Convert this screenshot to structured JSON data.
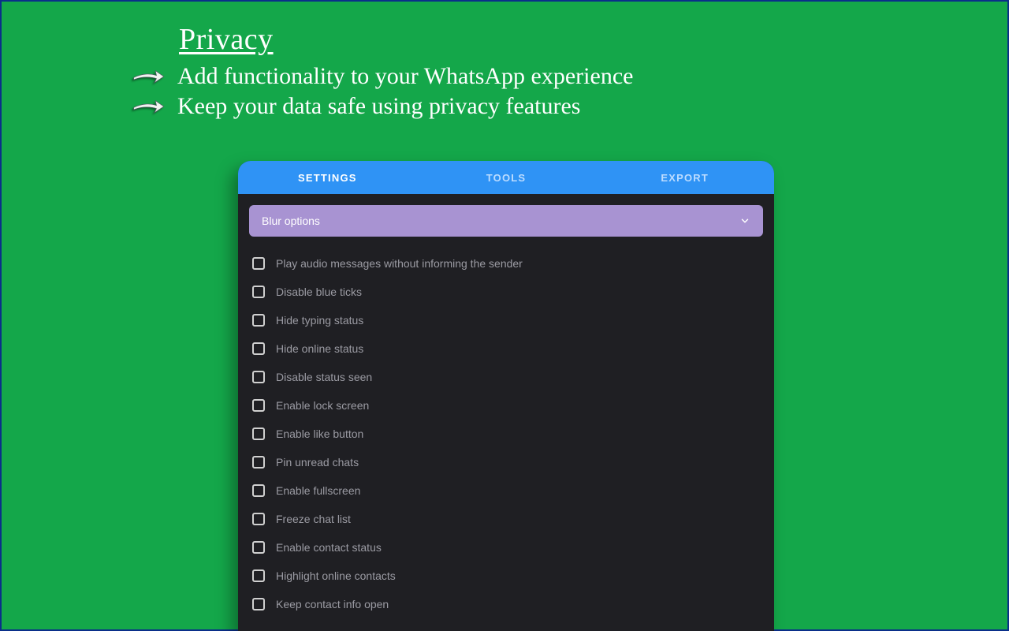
{
  "hero": {
    "title": "Privacy",
    "line1": "Add functionality to your WhatsApp experience",
    "line2": "Keep your data safe using privacy features"
  },
  "tabs": [
    {
      "label": "SETTINGS",
      "active": true
    },
    {
      "label": "TOOLS",
      "active": false
    },
    {
      "label": "EXPORT",
      "active": false
    }
  ],
  "dropdown": {
    "label": "Blur options"
  },
  "options": [
    {
      "label": "Play audio messages without informing the sender",
      "checked": false
    },
    {
      "label": "Disable blue ticks",
      "checked": false
    },
    {
      "label": "Hide typing status",
      "checked": false
    },
    {
      "label": "Hide online status",
      "checked": false
    },
    {
      "label": "Disable status seen",
      "checked": false
    },
    {
      "label": "Enable lock screen",
      "checked": false
    },
    {
      "label": "Enable like button",
      "checked": false
    },
    {
      "label": "Pin unread chats",
      "checked": false
    },
    {
      "label": "Enable fullscreen",
      "checked": false
    },
    {
      "label": "Freeze chat list",
      "checked": false
    },
    {
      "label": "Enable contact status",
      "checked": false
    },
    {
      "label": "Highlight online contacts",
      "checked": false
    },
    {
      "label": "Keep contact info open",
      "checked": false
    }
  ]
}
